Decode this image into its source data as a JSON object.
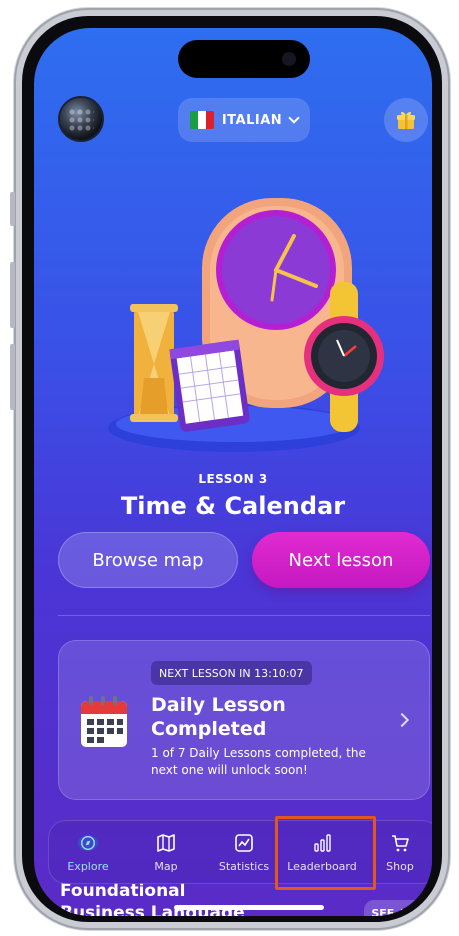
{
  "header": {
    "language_label": "ITALIAN",
    "flag_colors": [
      "#1a9e43",
      "#ffffff",
      "#d9222e"
    ]
  },
  "hero": {
    "lesson_kicker": "LESSON 3",
    "lesson_title": "Time & Calendar"
  },
  "actions": {
    "browse_label": "Browse map",
    "next_label": "Next lesson"
  },
  "daily_card": {
    "timer_text": "NEXT LESSON IN 13:10:07",
    "title": "Daily Lesson Completed",
    "description": "1 of 7 Daily Lessons completed, the next one will unlock soon!"
  },
  "tabs": [
    {
      "label": "Explore",
      "icon": "compass-icon",
      "active": true
    },
    {
      "label": "Map",
      "icon": "map-icon",
      "active": false
    },
    {
      "label": "Statistics",
      "icon": "statistics-icon",
      "active": false
    },
    {
      "label": "Leaderboard",
      "icon": "bar-chart-icon",
      "active": false
    },
    {
      "label": "Shop",
      "icon": "cart-icon",
      "active": false
    }
  ],
  "section": {
    "title_line1": "Foundational",
    "title_line2": "Business Language",
    "see_all_label": "SEE ALL"
  },
  "colors": {
    "accent_magenta": "#d11ec9",
    "highlight_orange": "#e2581c",
    "active_tab": "#9fe0ff"
  }
}
